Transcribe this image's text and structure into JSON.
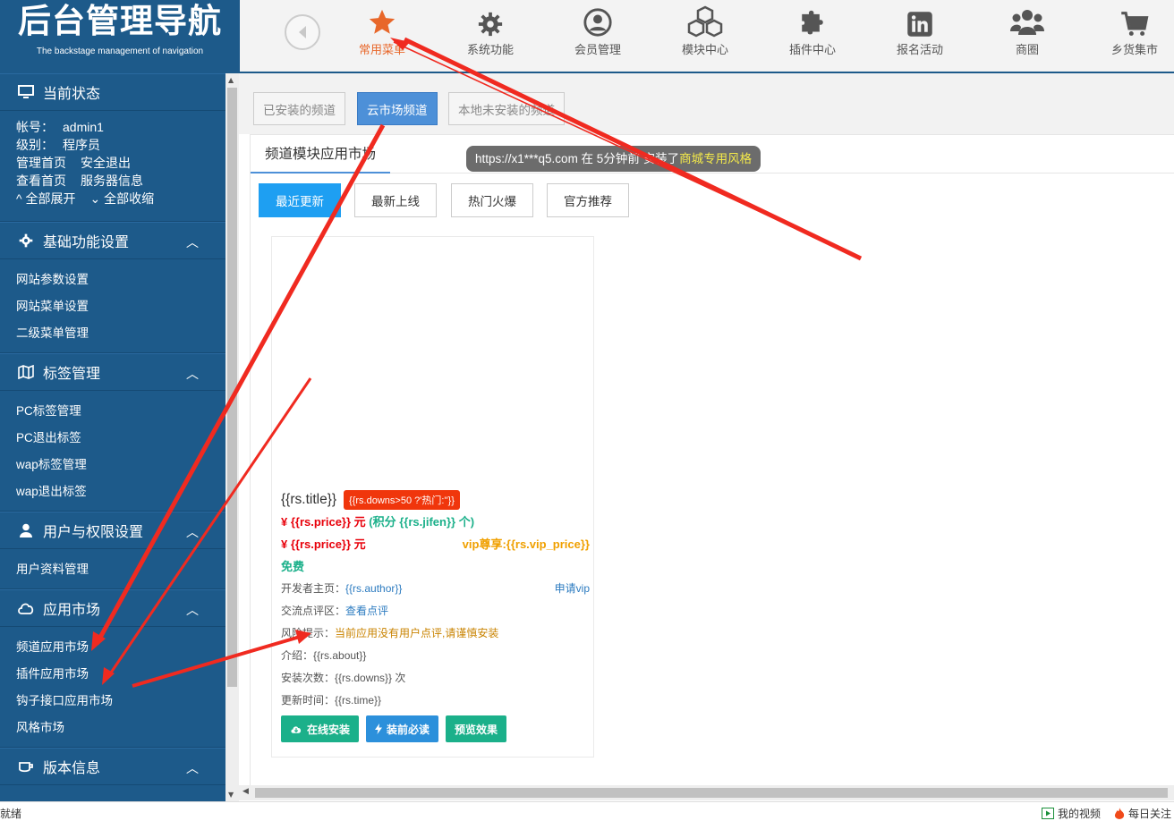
{
  "logo": {
    "title": "后台管理导航",
    "subtitle": "The backstage management of navigation"
  },
  "topnav": [
    {
      "label": "常用菜单",
      "icon": "star-icon",
      "active": true
    },
    {
      "label": "系统功能",
      "icon": "gear-icon"
    },
    {
      "label": "会员管理",
      "icon": "user-circle-icon"
    },
    {
      "label": "模块中心",
      "icon": "cubes-icon"
    },
    {
      "label": "插件中心",
      "icon": "puzzle-icon"
    },
    {
      "label": "报名活动",
      "icon": "linkedin-icon"
    },
    {
      "label": "商圈",
      "icon": "users-icon"
    },
    {
      "label": "乡货集市",
      "icon": "cart-icon"
    }
  ],
  "sidebar": {
    "status": {
      "title": "当前状态",
      "account_label": "帐号：",
      "account_value": "admin1",
      "level_label": "级别：",
      "level_value": "程序员",
      "links": [
        "管理首页",
        "安全退出",
        "查看首页",
        "服务器信息"
      ],
      "expand_all": "全部展开",
      "collapse_all": "全部收缩"
    },
    "sections": [
      {
        "title": "基础功能设置",
        "icon": "gear-icon",
        "items": [
          "网站参数设置",
          "网站菜单设置",
          "二级菜单管理"
        ]
      },
      {
        "title": "标签管理",
        "icon": "map-icon",
        "items": [
          "PC标签管理",
          "PC退出标签",
          "wap标签管理",
          "wap退出标签"
        ]
      },
      {
        "title": "用户与权限设置",
        "icon": "user-icon",
        "items": [
          "用户资料管理"
        ]
      },
      {
        "title": "应用市场",
        "icon": "cloud-icon",
        "items": [
          "频道应用市场",
          "插件应用市场",
          "钩子接口应用市场",
          "风格市场"
        ]
      },
      {
        "title": "版本信息",
        "icon": "coffee-icon",
        "items": []
      }
    ]
  },
  "main": {
    "tabs": [
      "已安装的频道",
      "云市场频道",
      "本地未安装的频道"
    ],
    "panel_title": "频道模块应用市场",
    "notice": {
      "text": "https://x1***q5.com 在 5分钟前 安装了",
      "highlight": "商城专用风格"
    },
    "filters": [
      "最近更新",
      "最新上线",
      "热门火爆",
      "官方推荐"
    ],
    "card": {
      "title": "{{rs.title}}",
      "hot_badge": "{{rs.downs>50 ?'热门:''}}",
      "price_line1": "¥ {{rs.price}} 元",
      "jifen": "(积分 {{rs.jifen}} 个)",
      "price_line2": "¥ {{rs.price}} 元",
      "vip_price": "vip尊享:{{rs.vip_price}}",
      "free": "免费",
      "dev_label": "开发者主页：",
      "dev_value": "{{rs.author}}",
      "apply_vip": "申请vip",
      "comment_label": "交流点评区：",
      "comment_value": "查看点评",
      "risk_label": "风险提示：",
      "risk_value": "当前应用没有用户点评,请谨慎安装",
      "about_label": "介绍：",
      "about_value": "{{rs.about}}",
      "downs_label": "安装次数：",
      "downs_value": "{{rs.downs}} 次",
      "time_label": "更新时间：",
      "time_value": "{{rs.time}}",
      "btn_install": "在线安装",
      "btn_read": "装前必读",
      "btn_preview": "预览效果"
    }
  },
  "statusbar": {
    "left": "就绪",
    "video": "我的视频",
    "follow": "每日关注"
  },
  "colors": {
    "sidebar": "#1d5a8a",
    "accent": "#e8672a",
    "primary": "#1e9ff2",
    "annotation": "#f02a20"
  }
}
